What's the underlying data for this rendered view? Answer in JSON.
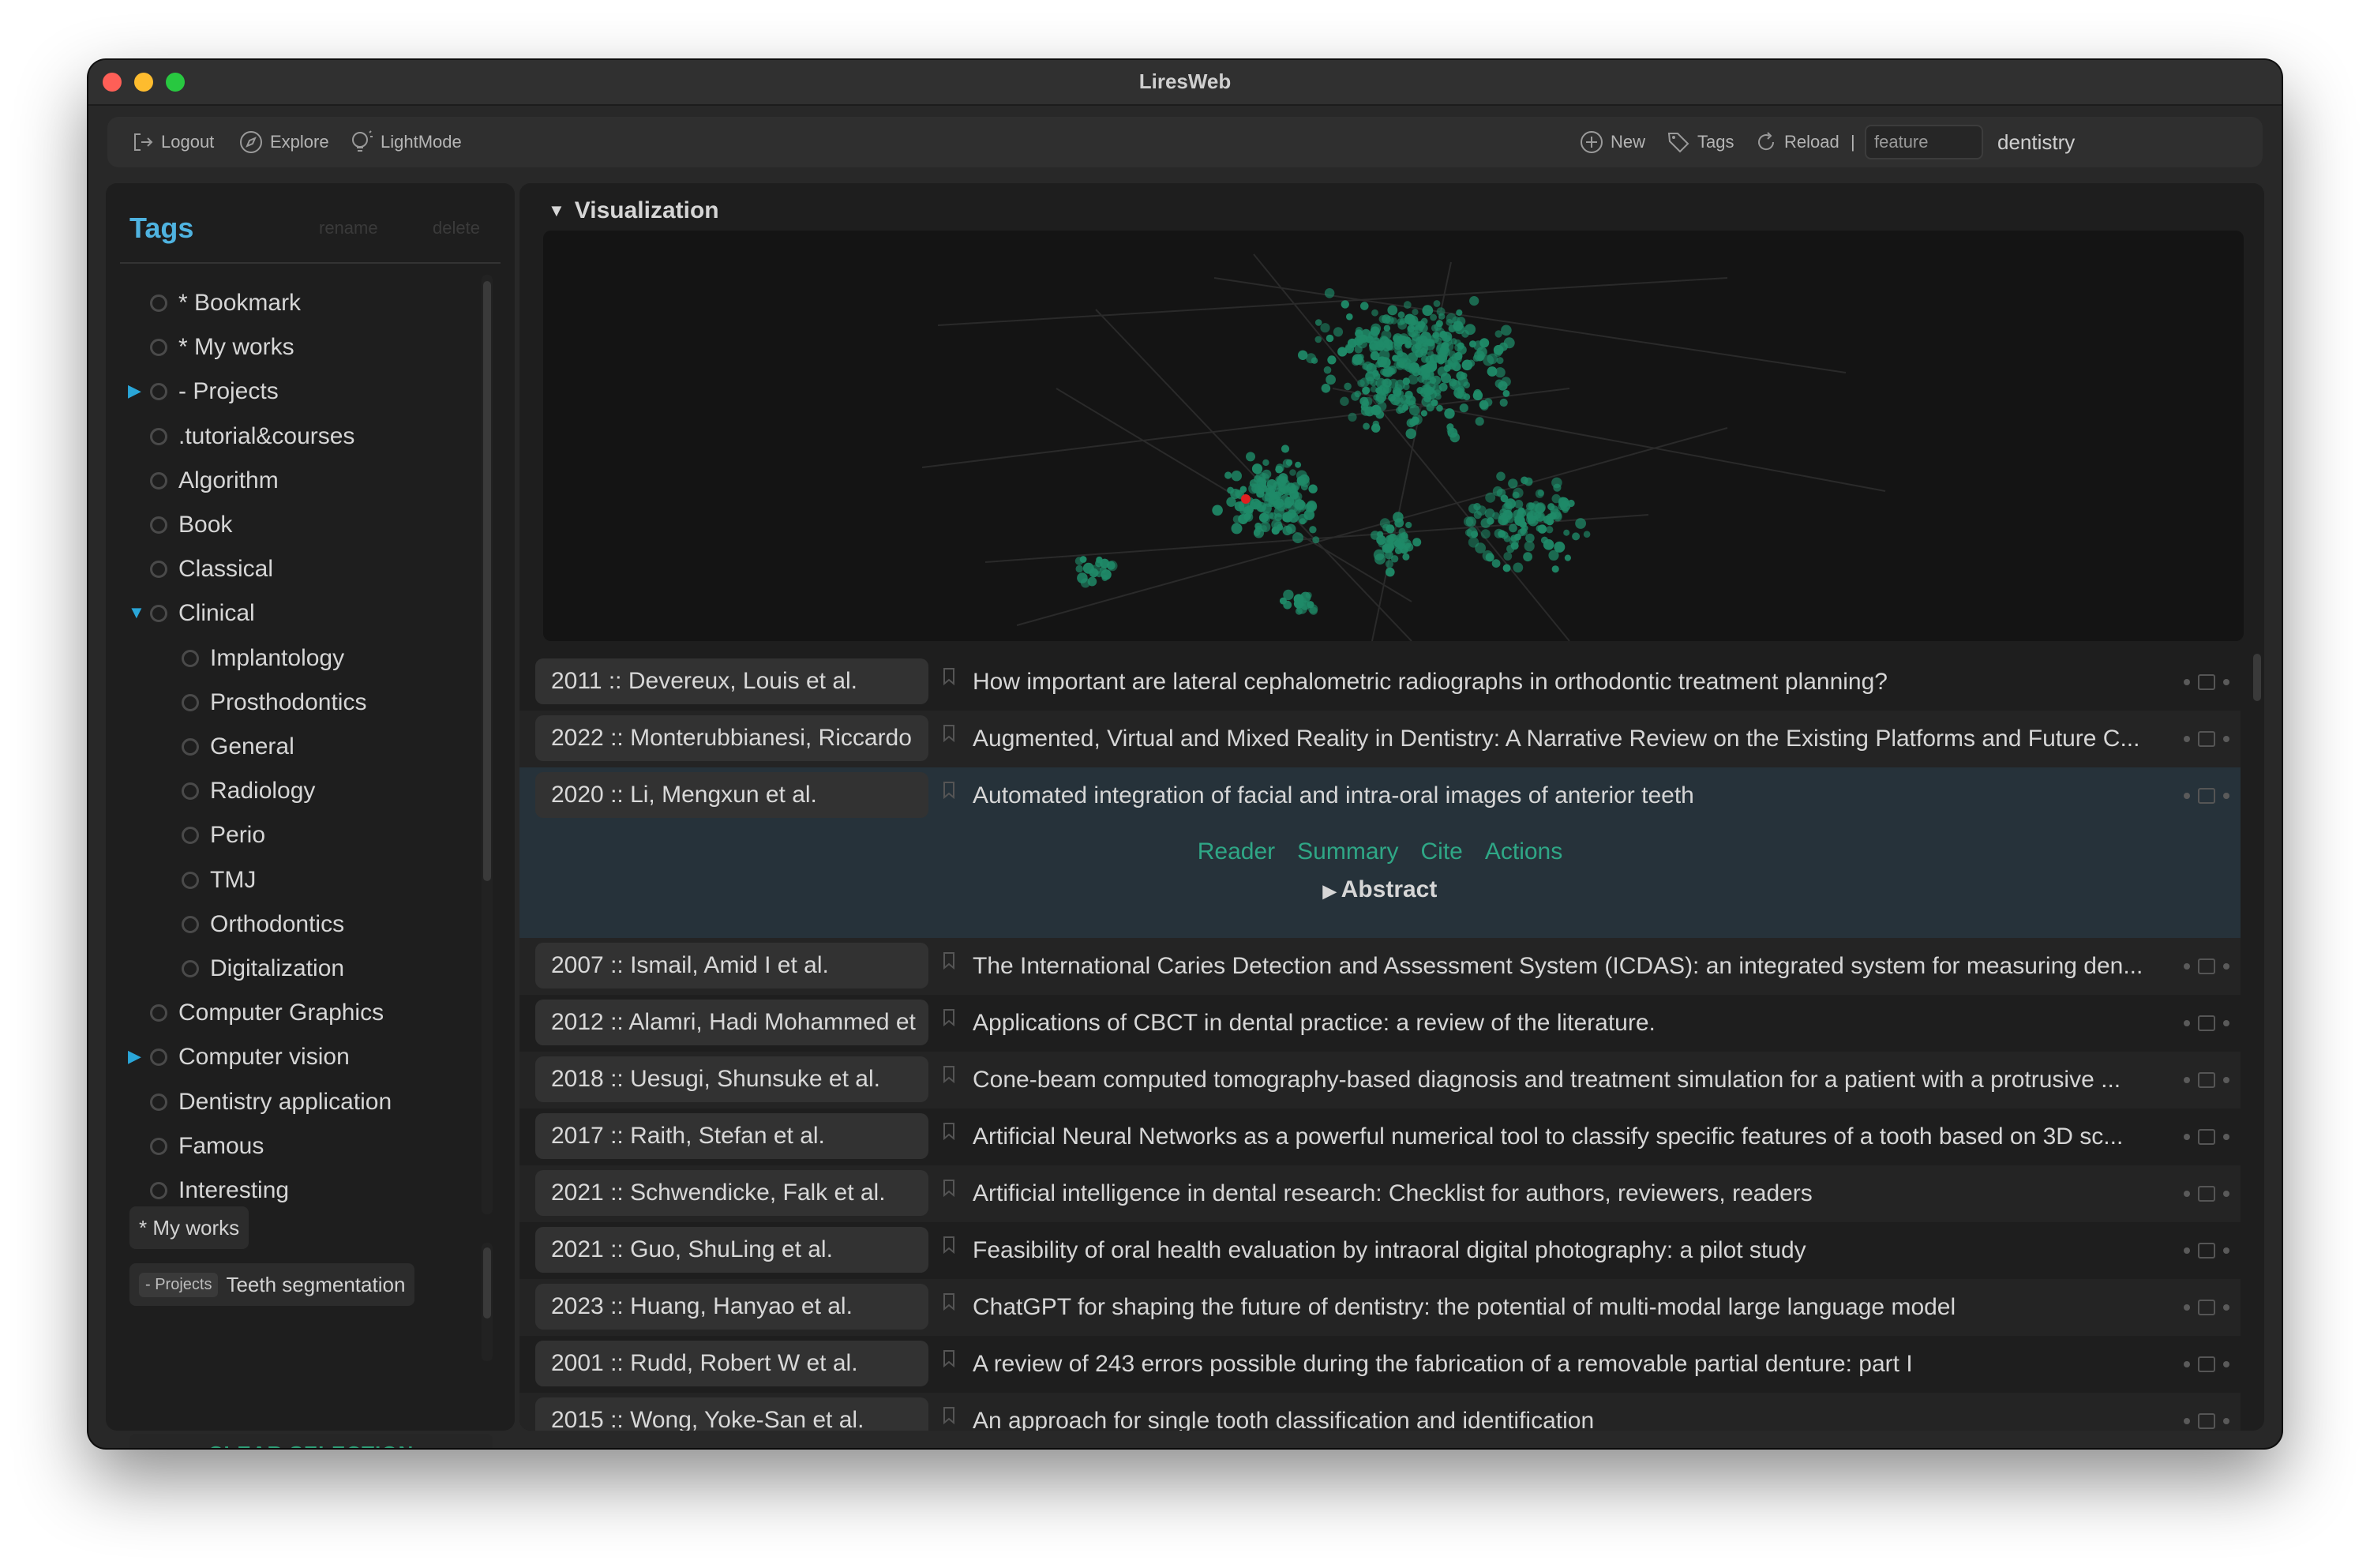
{
  "window": {
    "title": "LiresWeb",
    "traffic_lights": [
      "#fe5f57",
      "#febc2e",
      "#28c840"
    ]
  },
  "toolbar": {
    "logout": "Logout",
    "explore": "Explore",
    "lightmode": "LightMode",
    "new": "New",
    "tags": "Tags",
    "reload": "Reload",
    "separator": "|",
    "filter_value": "feature",
    "search_value": "dentistry"
  },
  "sidebar": {
    "title": "Tags",
    "rename": "rename",
    "delete": "delete",
    "tags": [
      {
        "label": "* Bookmark",
        "level": 0,
        "expand": ""
      },
      {
        "label": "* My works",
        "level": 0,
        "expand": ""
      },
      {
        "label": "- Projects",
        "level": 0,
        "expand": "▶"
      },
      {
        "label": ".tutorial&courses",
        "level": 0,
        "expand": ""
      },
      {
        "label": "Algorithm",
        "level": 0,
        "expand": ""
      },
      {
        "label": "Book",
        "level": 0,
        "expand": ""
      },
      {
        "label": "Classical",
        "level": 0,
        "expand": ""
      },
      {
        "label": "Clinical",
        "level": 0,
        "expand": "▼"
      },
      {
        "label": "Implantology",
        "level": 1,
        "expand": ""
      },
      {
        "label": "Prosthodontics",
        "level": 1,
        "expand": ""
      },
      {
        "label": "General",
        "level": 1,
        "expand": ""
      },
      {
        "label": "Radiology",
        "level": 1,
        "expand": ""
      },
      {
        "label": "Perio",
        "level": 1,
        "expand": ""
      },
      {
        "label": "TMJ",
        "level": 1,
        "expand": ""
      },
      {
        "label": "Orthodontics",
        "level": 1,
        "expand": ""
      },
      {
        "label": "Digitalization",
        "level": 1,
        "expand": ""
      },
      {
        "label": "Computer Graphics",
        "level": 0,
        "expand": ""
      },
      {
        "label": "Computer vision",
        "level": 0,
        "expand": "▶"
      },
      {
        "label": "Dentistry application",
        "level": 0,
        "expand": ""
      },
      {
        "label": "Famous",
        "level": 0,
        "expand": ""
      },
      {
        "label": "Interesting",
        "level": 0,
        "expand": ""
      }
    ],
    "selected": {
      "chip1": "* My works",
      "chip2_prefix": "- Projects",
      "chip2_label": "Teeth segmentation"
    },
    "clear_selection": "CLEAR SELECTION"
  },
  "visualization": {
    "label": "Visualization",
    "point_color": "#1f8a68",
    "highlight_color": "#e02020"
  },
  "expanded": {
    "reader": "Reader",
    "summary": "Summary",
    "cite": "Cite",
    "actions": "Actions",
    "abstract": "Abstract"
  },
  "entries": [
    {
      "author": "2011 :: Devereux, Louis et al.",
      "title": "How important are lateral cephalometric radiographs in orthodontic treatment planning?"
    },
    {
      "author": "2022 :: Monterubbianesi, Riccardo",
      "title": "Augmented, Virtual and Mixed Reality in Dentistry: A Narrative Review on the Existing Platforms and Future C..."
    },
    {
      "author": "2020 :: Li, Mengxun et al.",
      "title": "Automated integration of facial and intra-oral images of anterior teeth"
    },
    {
      "author": "2007 :: Ismail, Amid I et al.",
      "title": "The International Caries Detection and Assessment System (ICDAS): an integrated system for measuring den..."
    },
    {
      "author": "2012 :: Alamri, Hadi Mohammed et",
      "title": "Applications of CBCT in dental practice: a review of the literature."
    },
    {
      "author": "2018 :: Uesugi, Shunsuke et al.",
      "title": "Cone-beam computed tomography-based diagnosis and treatment simulation for a patient with a protrusive ..."
    },
    {
      "author": "2017 :: Raith, Stefan et al.",
      "title": "Artificial Neural Networks as a powerful numerical tool to classify specific features of a tooth based on 3D sc..."
    },
    {
      "author": "2021 :: Schwendicke, Falk et al.",
      "title": "Artificial intelligence in dental research: Checklist for authors, reviewers, readers"
    },
    {
      "author": "2021 :: Guo, ShuLing et al.",
      "title": "Feasibility of oral health evaluation by intraoral digital photography: a pilot study"
    },
    {
      "author": "2023 :: Huang, Hanyao et al.",
      "title": "ChatGPT for shaping the future of dentistry: the potential of multi-modal large language model"
    },
    {
      "author": "2001 :: Rudd, Robert W et al.",
      "title": "A review of 243 errors possible during the fabrication of a removable partial denture: part I"
    },
    {
      "author": "2015 :: Wong, Yoke-San et al.",
      "title": "An approach for single tooth classification and identification"
    }
  ]
}
